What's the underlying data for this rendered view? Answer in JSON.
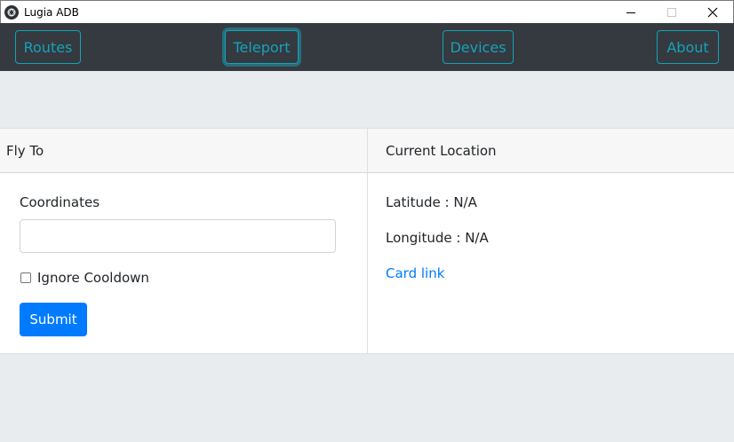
{
  "window": {
    "title": "Lugia ADB",
    "icon": "app-logo-icon",
    "controls": [
      "minimize-icon",
      "maximize-icon",
      "close-icon"
    ]
  },
  "nav": {
    "routes": "Routes",
    "teleport": "Teleport",
    "devices": "Devices",
    "about": "About",
    "active": "Teleport",
    "accent_color": "#17a2b8"
  },
  "fly_to": {
    "header": "Fly To",
    "coordinates_label": "Coordinates",
    "coordinates_value": "",
    "coordinates_placeholder": "",
    "ignore_cooldown_label": "Ignore Cooldown",
    "ignore_cooldown_checked": false,
    "submit_label": "Submit",
    "submit_color": "#007bff"
  },
  "current_location": {
    "header": "Current Location",
    "latitude": "Latitude : N/A",
    "longitude": "Longitude : N/A",
    "link": "Card link",
    "link_color": "#007bff"
  }
}
